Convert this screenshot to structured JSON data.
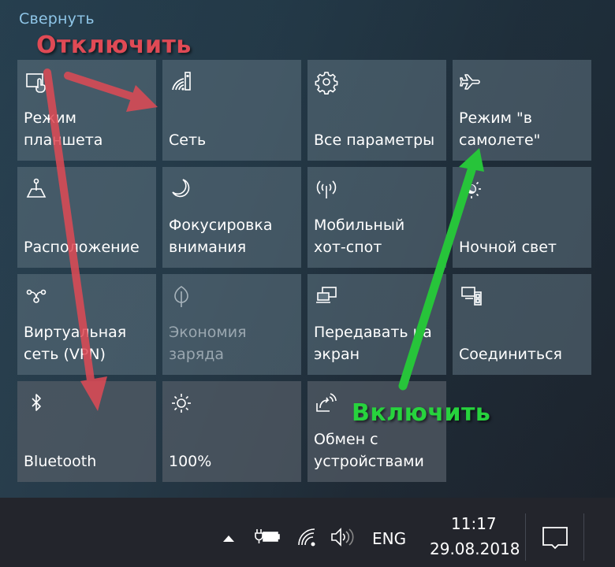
{
  "action_center": {
    "collapse_label": "Свернуть",
    "tiles": [
      {
        "label": "Режим\nпланшета",
        "icon": "tablet-mode-icon",
        "state": "off"
      },
      {
        "label": "Сеть",
        "icon": "network-icon",
        "state": "off"
      },
      {
        "label": "Все параметры",
        "icon": "gear-icon",
        "state": "off"
      },
      {
        "label": "Режим \"в\nсамолете\"",
        "icon": "airplane-icon",
        "state": "off"
      },
      {
        "label": "Расположение",
        "icon": "location-icon",
        "state": "off"
      },
      {
        "label": "Фокусировка\nвнимания",
        "icon": "moon-icon",
        "state": "off"
      },
      {
        "label": "Мобильный\nхот-спот",
        "icon": "hotspot-icon",
        "state": "off"
      },
      {
        "label": "Ночной свет",
        "icon": "night-light-icon",
        "state": "off"
      },
      {
        "label": "Виртуальная\nсеть (VPN)",
        "icon": "vpn-icon",
        "state": "off"
      },
      {
        "label": "Экономия\nзаряда",
        "icon": "battery-saver-icon",
        "state": "disabled"
      },
      {
        "label": "Передавать на\nэкран",
        "icon": "project-icon",
        "state": "off"
      },
      {
        "label": "Соединиться",
        "icon": "connect-icon",
        "state": "off"
      },
      {
        "label": "Bluetooth",
        "icon": "bluetooth-icon",
        "state": "off"
      },
      {
        "label": "100%",
        "icon": "brightness-icon",
        "state": "off"
      },
      {
        "label": "Обмен с\nустройствами",
        "icon": "nearby-sharing-icon",
        "state": "off"
      }
    ]
  },
  "annotations": {
    "disable_label": "Отключить",
    "enable_label": "Включить",
    "disable_color": "#e04a55",
    "enable_color": "#27d33d"
  },
  "taskbar": {
    "language": "ENG",
    "time": "11:17",
    "date": "29.08.2018",
    "icons": [
      "show-hidden-icons-icon",
      "battery-charging-icon",
      "wifi-icon",
      "volume-icon",
      "notifications-icon"
    ]
  }
}
